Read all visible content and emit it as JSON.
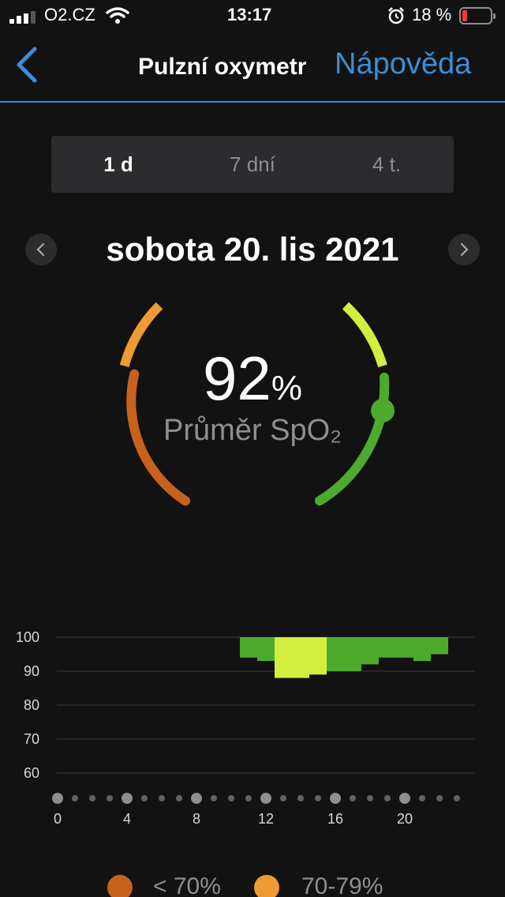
{
  "status_bar": {
    "carrier": "O2.CZ",
    "time": "13:17",
    "battery_percent": "18 %",
    "battery_level": 0.18,
    "signal_bars": 3
  },
  "nav": {
    "title": "Pulzní oxymetr",
    "help": "Nápověda",
    "back_icon": "chevron-left-icon"
  },
  "tabs": [
    {
      "label": "1 d",
      "active": true
    },
    {
      "label": "7 dní",
      "active": false
    },
    {
      "label": "4 t.",
      "active": false
    }
  ],
  "date": {
    "label": "sobota 20. lis 2021"
  },
  "summary": {
    "value": "92",
    "unit": "%",
    "label": "Průměr SpO₂"
  },
  "colors": {
    "accent": "#3a8fd6",
    "below_70": "#c8611e",
    "r70_79": "#ef9a33",
    "r80_89": "#d2ee3f",
    "r90_100": "#4eaa2c"
  },
  "chart_data": {
    "type": "bar",
    "title": "",
    "xlabel": "",
    "ylabel": "",
    "x_ticks": [
      0,
      4,
      8,
      12,
      16,
      20
    ],
    "y_ticks": [
      60,
      70,
      80,
      90,
      100
    ],
    "ylim": [
      60,
      100
    ],
    "xlim": [
      0,
      23
    ],
    "grid": true,
    "bars": [
      {
        "x0": 10.5,
        "x1": 11.5,
        "top": 100,
        "bottom": 94,
        "color": "#4eaa2c"
      },
      {
        "x0": 11.5,
        "x1": 12.5,
        "top": 100,
        "bottom": 93,
        "color": "#4eaa2c"
      },
      {
        "x0": 12.5,
        "x1": 14.5,
        "top": 100,
        "bottom": 88,
        "color": "#d2ee3f"
      },
      {
        "x0": 14.5,
        "x1": 15.5,
        "top": 100,
        "bottom": 89,
        "color": "#d2ee3f"
      },
      {
        "x0": 15.5,
        "x1": 17.5,
        "top": 100,
        "bottom": 90,
        "color": "#4eaa2c"
      },
      {
        "x0": 17.5,
        "x1": 18.5,
        "top": 100,
        "bottom": 92,
        "color": "#4eaa2c"
      },
      {
        "x0": 18.5,
        "x1": 20.5,
        "top": 100,
        "bottom": 94,
        "color": "#4eaa2c"
      },
      {
        "x0": 20.5,
        "x1": 21.5,
        "top": 100,
        "bottom": 93,
        "color": "#4eaa2c"
      },
      {
        "x0": 21.5,
        "x1": 22.5,
        "top": 100,
        "bottom": 95,
        "color": "#4eaa2c"
      }
    ]
  },
  "legend": [
    {
      "label": "< 70%",
      "color": "#c8611e"
    },
    {
      "label": "70-79%",
      "color": "#ef9a33"
    }
  ]
}
